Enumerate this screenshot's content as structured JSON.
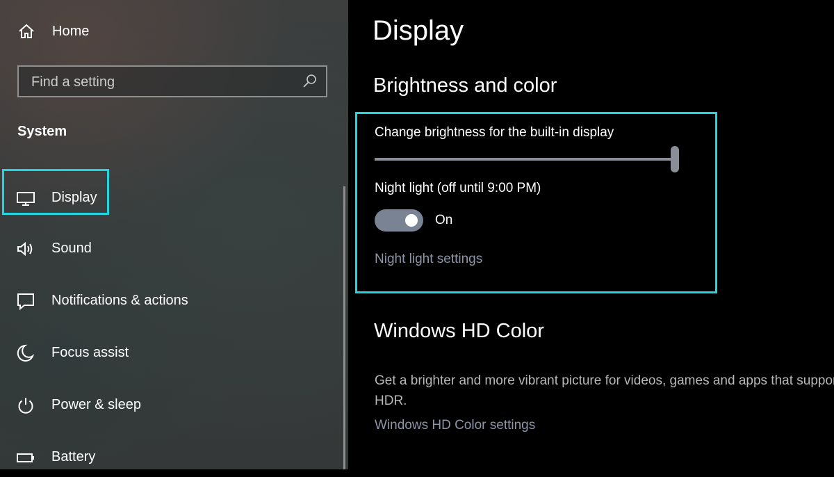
{
  "sidebar": {
    "home_label": "Home",
    "search_placeholder": "Find a setting",
    "section_title": "System",
    "items": [
      {
        "label": "Display",
        "icon": "monitor-icon",
        "selected": true
      },
      {
        "label": "Sound",
        "icon": "speaker-icon"
      },
      {
        "label": "Notifications & actions",
        "icon": "message-icon"
      },
      {
        "label": "Focus assist",
        "icon": "moon-icon"
      },
      {
        "label": "Power & sleep",
        "icon": "power-icon"
      },
      {
        "label": "Battery",
        "icon": "battery-icon"
      }
    ]
  },
  "main": {
    "page_title": "Display",
    "brightness_section_title": "Brightness and color",
    "brightness_label": "Change brightness for the built-in display",
    "brightness_value": 100,
    "night_light_label": "Night light (off until 9:00 PM)",
    "night_light_toggle": {
      "state": "On",
      "on": true
    },
    "night_light_link": "Night light settings",
    "hd_color_title": "Windows HD Color",
    "hd_color_description": "Get a brighter and more vibrant picture for videos, games and apps that support HDR.",
    "hd_color_link": "Windows HD Color settings"
  },
  "colors": {
    "highlight": "#22d6e0",
    "link": "#8d95a8",
    "toggle_on": "#7a8394"
  }
}
